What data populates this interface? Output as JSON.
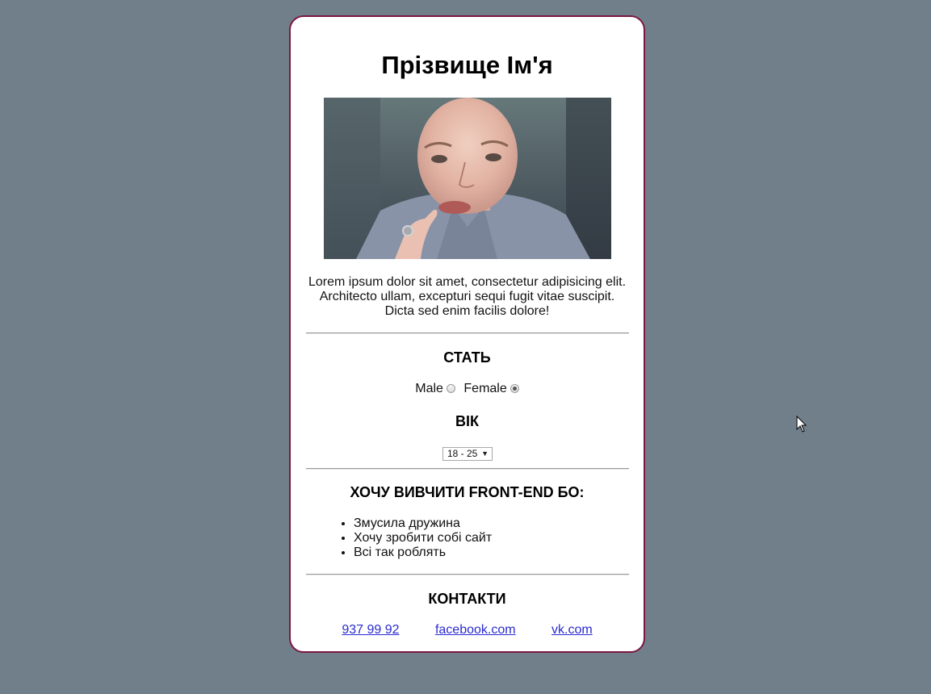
{
  "card": {
    "title": "Прізвище Ім'я",
    "photo_alt": "photo",
    "description": "Lorem ipsum dolor sit amet, consectetur adipisicing elit. Architecto ullam, excepturi sequi fugit vitae suscipit. Dicta sed enim facilis dolore!",
    "gender": {
      "heading": "СТАТЬ",
      "options": [
        {
          "label": "Male",
          "checked": false
        },
        {
          "label": "Female",
          "checked": true
        }
      ]
    },
    "age": {
      "heading": "ВІК",
      "selected": "18 - 25"
    },
    "reasons": {
      "heading": "ХОЧУ ВИВЧИТИ FRONT-END БО:",
      "items": [
        "Змусила дружина",
        "Хочу зробити собі сайт",
        "Всі так роблять"
      ]
    },
    "contacts": {
      "heading": "КОНТАКТИ",
      "links": [
        "937 99 92",
        "facebook.com",
        "vk.com"
      ]
    }
  },
  "colors": {
    "page_background": "#717f8b",
    "card_border": "#7a1742",
    "link": "#2a2ad0"
  }
}
